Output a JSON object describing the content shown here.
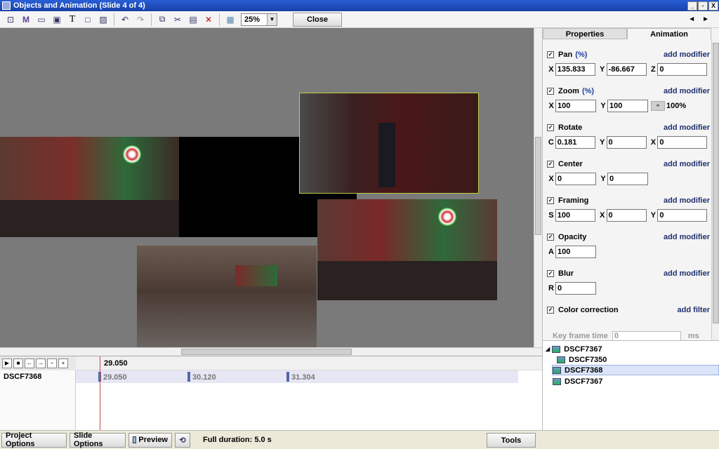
{
  "window": {
    "title": "Objects and Animation (Slide 4 of 4)",
    "min": "_",
    "max": "▫",
    "close": "X"
  },
  "toolbar": {
    "zoom": "25%",
    "close_label": "Close",
    "prev": "◄",
    "next": "►"
  },
  "timeline": {
    "current_time": "29.050",
    "track_name": "DSCF7368",
    "keyframes": [
      "29.050",
      "30.120",
      "31.304"
    ]
  },
  "panel": {
    "tabs": [
      "Properties",
      "Animation"
    ],
    "pan": {
      "label": "Pan",
      "unit": "(%)",
      "x": "135.833",
      "y": "-86.667",
      "z": "0",
      "mod": "add modifier"
    },
    "zoom": {
      "label": "Zoom",
      "unit": "(%)",
      "x": "100",
      "y": "100",
      "pct": "100%",
      "mod": "add modifier"
    },
    "rotate": {
      "label": "Rotate",
      "c": "0.181",
      "y": "0",
      "x": "0",
      "mod": "add modifier"
    },
    "center": {
      "label": "Center",
      "x": "0",
      "y": "0",
      "mod": "add modifier"
    },
    "framing": {
      "label": "Framing",
      "s": "100",
      "x": "0",
      "y": "0",
      "mod": "add modifier"
    },
    "opacity": {
      "label": "Opacity",
      "a": "100",
      "mod": "add modifier"
    },
    "blur": {
      "label": "Blur",
      "r": "0",
      "mod": "add modifier"
    },
    "color": {
      "label": "Color correction",
      "mod": "add filter"
    },
    "keyframe": {
      "label": "Key frame time",
      "value": "0",
      "unit": "ms"
    }
  },
  "tree": [
    "DSCF7367",
    "DSCF7350",
    "DSCF7368",
    "DSCF7367"
  ],
  "bottom": {
    "project_options": "Project Options",
    "slide_options": "Slide Options",
    "preview": "Preview",
    "duration": "Full duration: 5.0 s",
    "tools": "Tools"
  }
}
